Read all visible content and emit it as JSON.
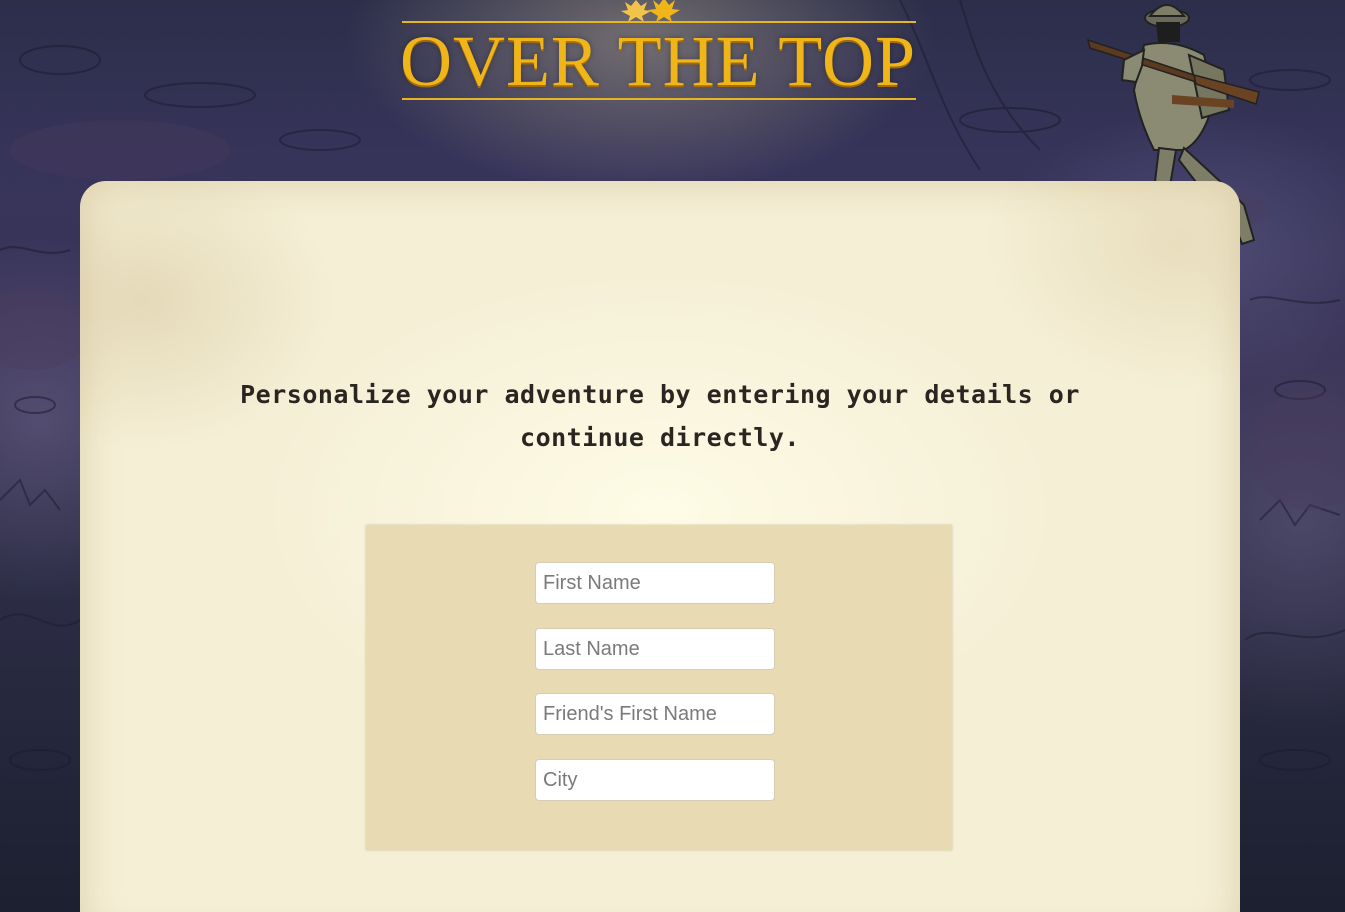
{
  "header": {
    "logo_text": "OVER THE TOP",
    "logo_color": "#f0b619"
  },
  "main": {
    "intro_text": "Personalize your adventure by entering your details or continue directly.",
    "form": {
      "fields": [
        {
          "placeholder": "First Name",
          "value": ""
        },
        {
          "placeholder": "Last Name",
          "value": ""
        },
        {
          "placeholder": "Friend's First Name",
          "value": ""
        },
        {
          "placeholder": "City",
          "value": ""
        }
      ]
    }
  },
  "colors": {
    "parchment": "#f5efd6",
    "form_panel": "#e8dab3",
    "text": "#2a2520"
  },
  "icons": {
    "logo_ornament": "maple-leaves-icon",
    "soldier": "soldier-illustration"
  }
}
